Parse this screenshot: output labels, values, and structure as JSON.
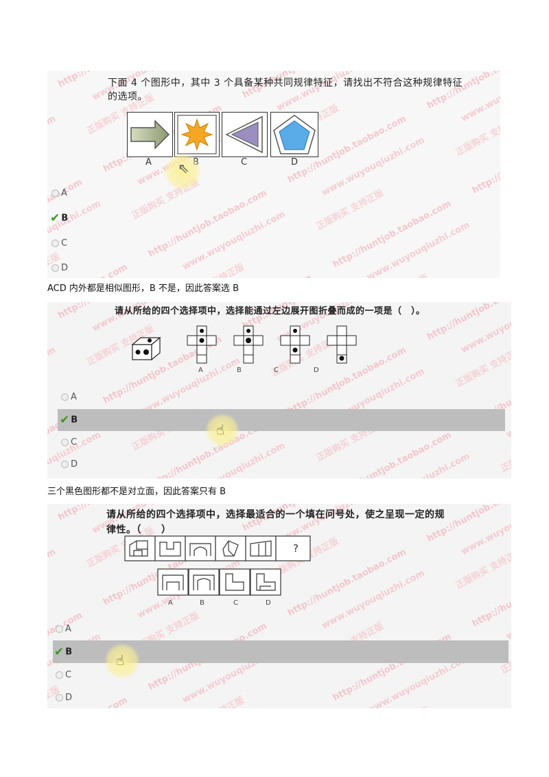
{
  "questions": [
    {
      "text_line1": "下面 4 个图形中，其中 3 个具备某种共同规律特征，请找出不符合这种规律特征",
      "text_line2": "的选项。",
      "figure_labels": [
        "A",
        "B",
        "C",
        "D"
      ],
      "options": [
        "A",
        "B",
        "C",
        "D"
      ],
      "selected": "B",
      "explanation": "ACD 内外都是相似图形，B 不是，因此答案选 B"
    },
    {
      "text_line1": "请从所给的四个选择项中，选择能通过左边展开图折叠而成的一项是（　）。",
      "figure_labels": [
        "A",
        "B",
        "C",
        "D"
      ],
      "options": [
        "A",
        "B",
        "C",
        "D"
      ],
      "selected": "B",
      "explanation": "三个黑色图形都不是对立面，因此答案只有 B"
    },
    {
      "text_line1": "请从所给的四个选择项中，选择最适合的一个填在问号处，使之呈现一定的规",
      "text_line2": "律性。（　　）",
      "question_mark": "?",
      "figure_labels": [
        "A",
        "B",
        "C",
        "D"
      ],
      "options": [
        "A",
        "B",
        "C",
        "D"
      ],
      "selected": "B"
    }
  ],
  "colors": {
    "check": "#3a9a1a",
    "highlight": "#bdbdbd",
    "watermark": "#e87a8a"
  },
  "icons": [
    "arrow-shape",
    "star-shape",
    "triangle-shape",
    "pentagon-shape",
    "checkmark-icon",
    "radio-icon",
    "hand-cursor-icon",
    "arrow-cursor-icon"
  ]
}
